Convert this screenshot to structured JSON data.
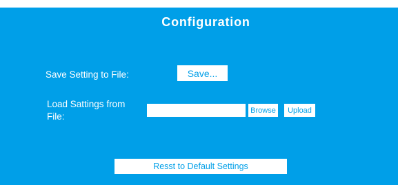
{
  "page": {
    "title": "Configuration"
  },
  "save": {
    "label": "Save Setting to File:",
    "button_label": "Save..."
  },
  "load": {
    "label_line1": "Load Sattings from",
    "label_line2": "File:",
    "file_value": "",
    "browse_label": "Browse",
    "upload_label": "Upload"
  },
  "reset": {
    "button_label": "Resst to Default Settings"
  },
  "colors": {
    "panel": "#009fe8",
    "text": "#ffffff"
  }
}
